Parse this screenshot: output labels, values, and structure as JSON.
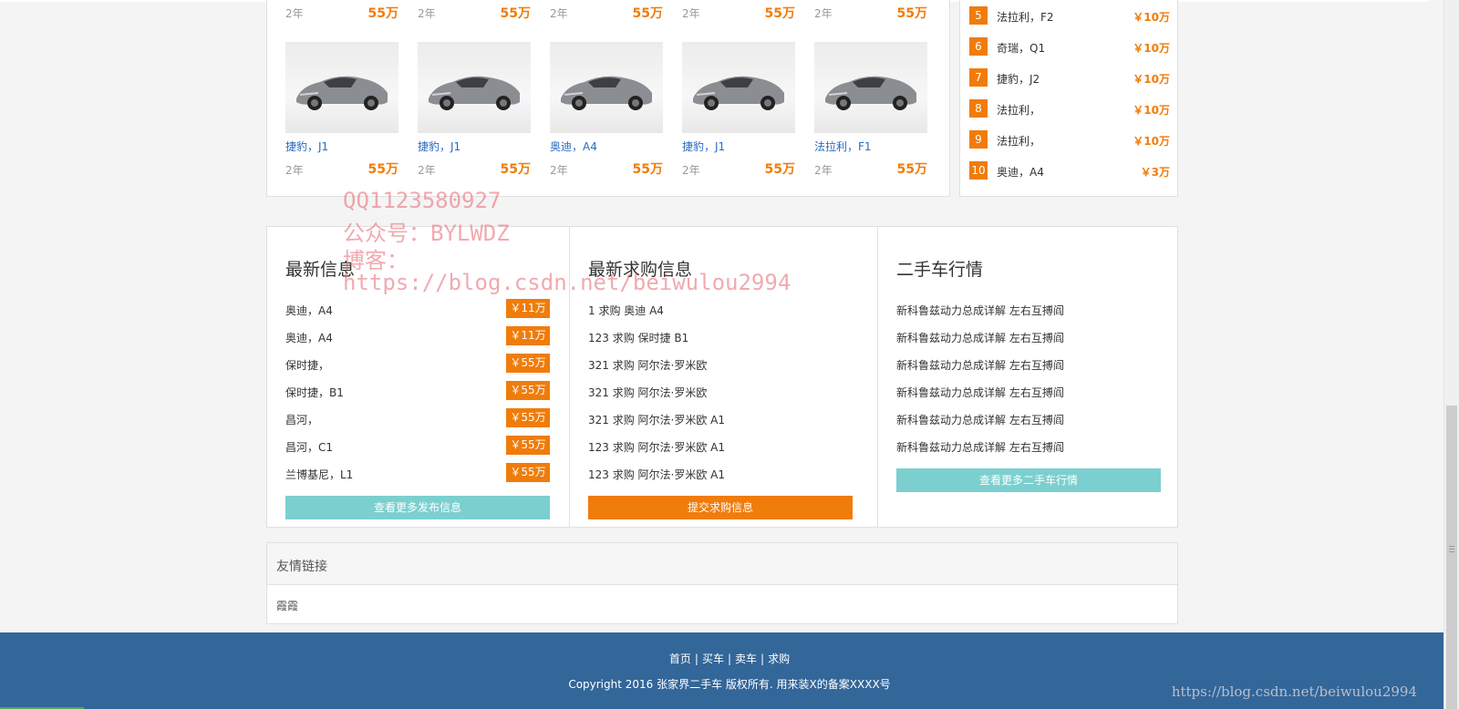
{
  "car_grid": {
    "top_row": [
      {
        "age": "2年",
        "price": "55万"
      },
      {
        "age": "2年",
        "price": "55万"
      },
      {
        "age": "2年",
        "price": "55万"
      },
      {
        "age": "2年",
        "price": "55万"
      },
      {
        "age": "2年",
        "price": "55万"
      }
    ],
    "cars": [
      {
        "name": "捷豹，J1",
        "age": "2年",
        "price": "55万"
      },
      {
        "name": "捷豹，J1",
        "age": "2年",
        "price": "55万"
      },
      {
        "name": "奥迪，A4",
        "age": "2年",
        "price": "55万"
      },
      {
        "name": "捷豹，J1",
        "age": "2年",
        "price": "55万"
      },
      {
        "name": "法拉利，F1",
        "age": "2年",
        "price": "55万"
      }
    ]
  },
  "ranking": [
    {
      "num": "5",
      "name": "法拉利，F2",
      "price": "￥10万"
    },
    {
      "num": "6",
      "name": "奇瑞，Q1",
      "price": "￥10万"
    },
    {
      "num": "7",
      "name": "捷豹，J2",
      "price": "￥10万"
    },
    {
      "num": "8",
      "name": "法拉利，",
      "price": "￥10万"
    },
    {
      "num": "9",
      "name": "法拉利，",
      "price": "￥10万"
    },
    {
      "num": "10",
      "name": "奥迪，A4",
      "price": "￥3万"
    }
  ],
  "latest_info": {
    "title": "最新信息",
    "rows": [
      {
        "text": "奥迪，A4",
        "price": "￥11万"
      },
      {
        "text": "奥迪，A4",
        "price": "￥11万"
      },
      {
        "text": "保时捷，",
        "price": "￥55万"
      },
      {
        "text": "保时捷，B1",
        "price": "￥55万"
      },
      {
        "text": "昌河，",
        "price": "￥55万"
      },
      {
        "text": "昌河，C1",
        "price": "￥55万"
      },
      {
        "text": "兰博基尼，L1",
        "price": "￥55万"
      }
    ],
    "button": "查看更多发布信息"
  },
  "purchase_info": {
    "title": "最新求购信息",
    "rows": [
      "1 求购 奥迪 A4",
      "123 求购 保时捷 B1",
      "321 求购 阿尔法·罗米欧",
      "321 求购 阿尔法·罗米欧",
      "321 求购 阿尔法·罗米欧 A1",
      "123 求购 阿尔法·罗米欧 A1",
      "123 求购 阿尔法·罗米欧 A1"
    ],
    "button": "提交求购信息"
  },
  "market_info": {
    "title": "二手车行情",
    "rows": [
      "新科鲁兹动力总成详解 左右互搏阎",
      "新科鲁兹动力总成详解 左右互搏阎",
      "新科鲁兹动力总成详解 左右互搏阎",
      "新科鲁兹动力总成详解 左右互搏阎",
      "新科鲁兹动力总成详解 左右互搏阎",
      "新科鲁兹动力总成详解 左右互搏阎"
    ],
    "button": "查看更多二手车行情"
  },
  "friend_links": {
    "title": "友情链接",
    "link": "霞霞"
  },
  "footer": {
    "nav": [
      "首页",
      "买车",
      "卖车",
      "求购"
    ],
    "separator": "|",
    "copyright": "Copyright 2016 张家界二手车 版权所有. 用来装X的备案XXXX号"
  },
  "watermark": {
    "line1": "QQ1123580927",
    "line2": "公众号：BYLWDZ",
    "line3": "博客：",
    "line4": "https://blog.csdn.net/beiwulou2994",
    "corner": "https://blog.csdn.net/beiwulou2994"
  },
  "colors": {
    "accent_orange": "#f07c0a",
    "teal": "#7ccfcf",
    "footer_blue": "#336699",
    "link_blue": "#2a6cc4"
  }
}
